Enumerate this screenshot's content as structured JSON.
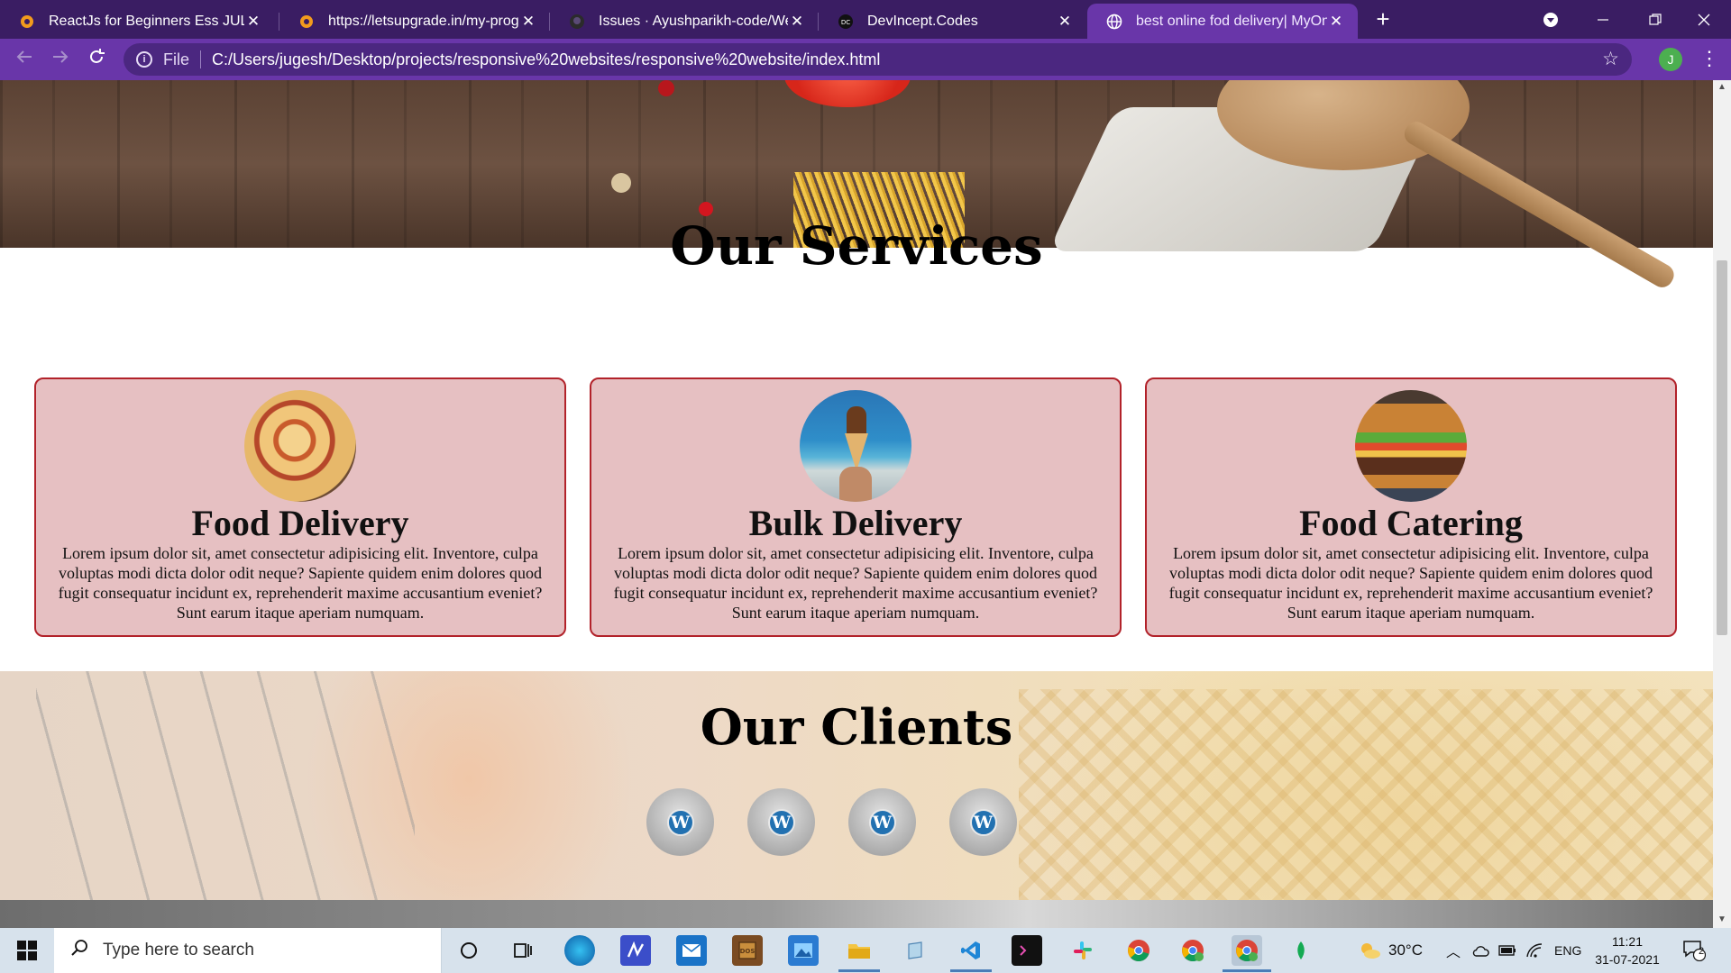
{
  "browser": {
    "tabs": [
      {
        "title": "ReactJs for Beginners Ess JUL",
        "icon": "letsupgrade-icon",
        "active": false
      },
      {
        "title": "https://letsupgrade.in/my-progra",
        "icon": "letsupgrade-icon",
        "active": false
      },
      {
        "title": "Issues · Ayushparikh-code/Web-d",
        "icon": "github-icon",
        "active": false
      },
      {
        "title": "DevIncept.Codes",
        "icon": "devincept-icon",
        "active": false
      },
      {
        "title": "best online fod delivery| MyOnlin",
        "icon": "globe-icon",
        "active": true
      }
    ],
    "new_tab": "+",
    "omnibox": {
      "scheme_label": "File",
      "url": "C:/Users/jugesh/Desktop/projects/responsive%20websites/responsive%20website/index.html"
    },
    "profile_initial": "J",
    "accent_color": "#6936a9"
  },
  "page": {
    "services": {
      "title": "Our Services",
      "cards": [
        {
          "title": "Food Delivery",
          "image": "pizza-image",
          "text": "Lorem ipsum dolor sit, amet consectetur adipisicing elit. Inventore, culpa voluptas modi dicta dolor odit neque? Sapiente quidem enim dolores quod fugit consequatur incidunt ex, reprehenderit maxime accusantium eveniet? Sunt earum itaque aperiam numquam."
        },
        {
          "title": "Bulk Delivery",
          "image": "ice-cream-image",
          "text": "Lorem ipsum dolor sit, amet consectetur adipisicing elit. Inventore, culpa voluptas modi dicta dolor odit neque? Sapiente quidem enim dolores quod fugit consequatur incidunt ex, reprehenderit maxime accusantium eveniet? Sunt earum itaque aperiam numquam."
        },
        {
          "title": "Food Catering",
          "image": "burger-image",
          "text": "Lorem ipsum dolor sit, amet consectetur adipisicing elit. Inventore, culpa voluptas modi dicta dolor odit neque? Sapiente quidem enim dolores quod fugit consequatur incidunt ex, reprehenderit maxime accusantium eveniet? Sunt earum itaque aperiam numquam."
        }
      ],
      "card_bg": "#e6c0c2",
      "card_border": "#b2222a"
    },
    "clients": {
      "title": "Our Clients",
      "logos": [
        "W",
        "W",
        "W",
        "W"
      ]
    }
  },
  "taskbar": {
    "search_placeholder": "Type here to search",
    "weather": "30°C",
    "language": "ENG",
    "time": "11:21",
    "date": "31-07-2021",
    "notification_count": "2"
  }
}
